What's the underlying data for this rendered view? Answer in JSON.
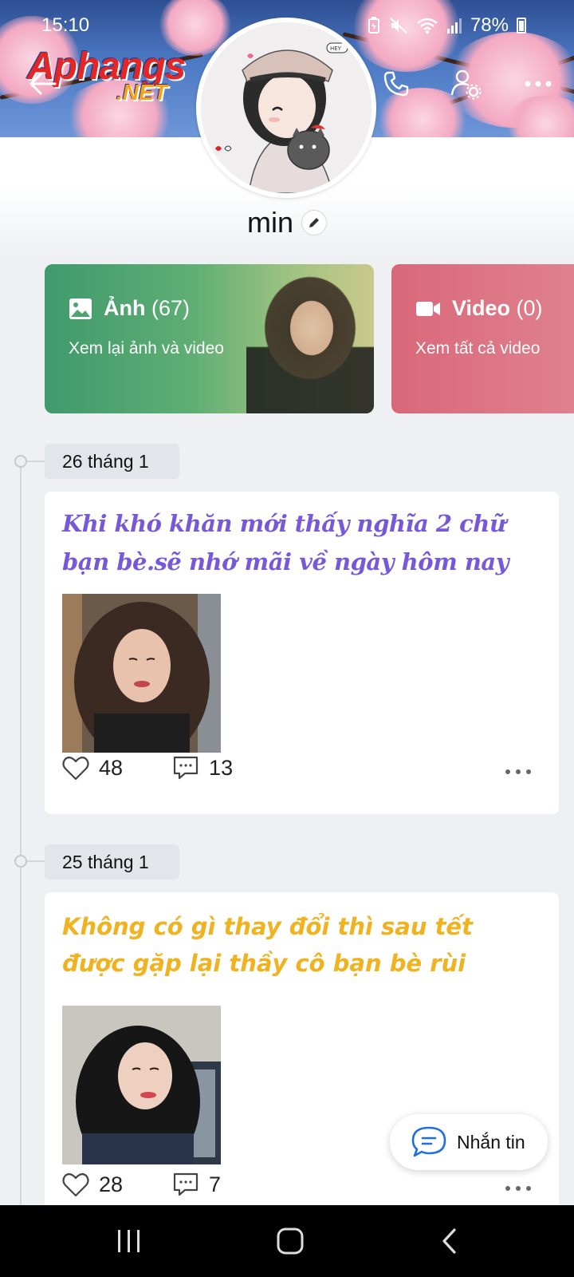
{
  "status_bar": {
    "time": "15:10",
    "battery": "78%"
  },
  "watermark": {
    "line1": "Aphangs",
    "line2": ".NET"
  },
  "profile": {
    "name": "min"
  },
  "media": {
    "photos": {
      "label": "Ảnh",
      "count": "(67)",
      "subtitle": "Xem lại ảnh và video"
    },
    "videos": {
      "label": "Video",
      "count": "(0)",
      "subtitle": "Xem tất cả video"
    }
  },
  "posts": [
    {
      "date": "26 tháng 1",
      "caption": "Khi khó khăn mới thấy nghĩa 2 chữ bạn bè.sẽ nhớ mãi về ngày hôm nay",
      "likes": "48",
      "comments": "13"
    },
    {
      "date": "25 tháng 1",
      "caption": "Không có gì thay đổi thì sau tết được gặp lại thầy cô bạn bè rùi",
      "likes": "28",
      "comments": "7"
    }
  ],
  "message_button": {
    "label": "Nhắn tin"
  },
  "colors": {
    "photos_card": "#4fa46e",
    "videos_card": "#dc6e7e",
    "post1_caption": "#7658d8",
    "post2_caption": "#f0b21f"
  }
}
